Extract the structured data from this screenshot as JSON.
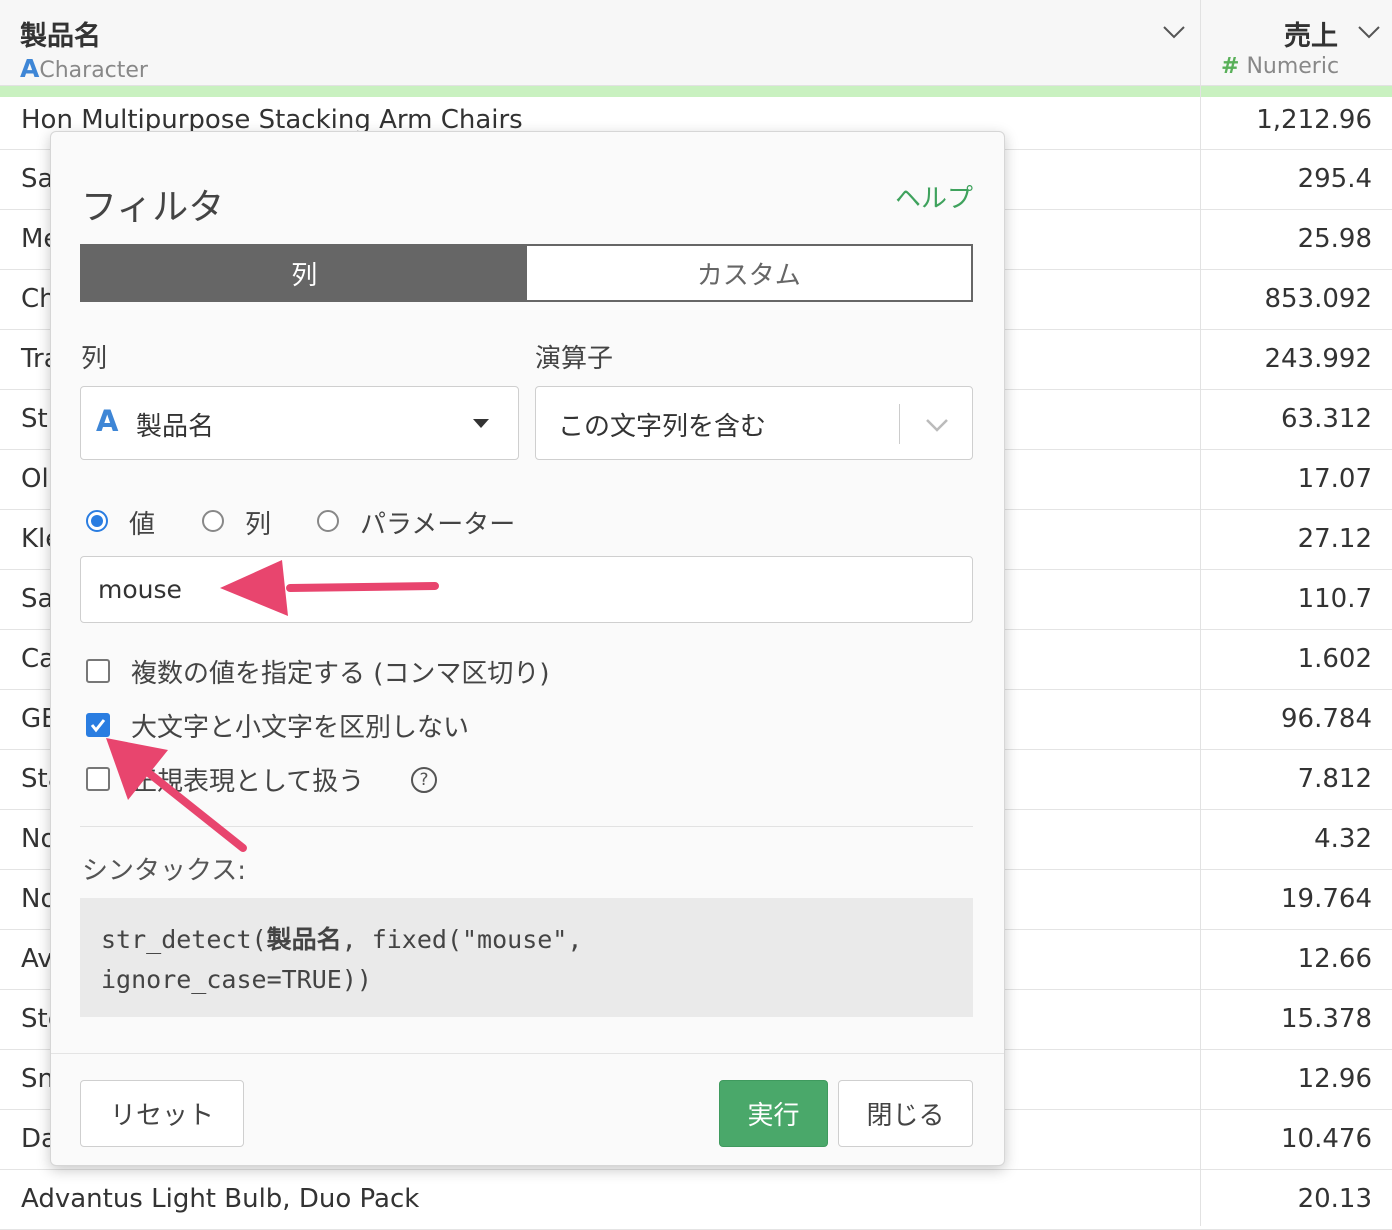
{
  "table": {
    "columns": [
      {
        "name": "製品名",
        "type_icon": "A",
        "type": "Character"
      },
      {
        "name": "売上",
        "type_icon": "#",
        "type": "Numeric"
      }
    ],
    "rows": [
      {
        "name": "Hon Multipurpose Stacking Arm Chairs",
        "value": "1,212.96"
      },
      {
        "name": "Sa",
        "value": "295.4"
      },
      {
        "name": "Me",
        "value": "25.98"
      },
      {
        "name": "Ch",
        "value": "853.092"
      },
      {
        "name": "Tra",
        "value": "243.992"
      },
      {
        "name": "St",
        "value": "63.312"
      },
      {
        "name": "Ol",
        "value": "17.07"
      },
      {
        "name": "Kle",
        "value": "27.12"
      },
      {
        "name": "Sa",
        "value": "110.7"
      },
      {
        "name": "Ca",
        "value": "1.602"
      },
      {
        "name": "GE",
        "value": "96.784"
      },
      {
        "name": "Sta",
        "value": "7.812"
      },
      {
        "name": "No",
        "value": "4.32"
      },
      {
        "name": "No",
        "value": "19.764"
      },
      {
        "name": "Av",
        "value": "12.66"
      },
      {
        "name": "Ste",
        "value": "15.378"
      },
      {
        "name": "Sn",
        "value": "12.96"
      },
      {
        "name": "Da",
        "value": "10.476"
      },
      {
        "name": "Advantus Light Bulb, Duo Pack",
        "value": "20.13"
      }
    ]
  },
  "dialog": {
    "title": "フィルタ",
    "help": "ヘルプ",
    "tabs": {
      "column": "列",
      "custom": "カスタム"
    },
    "column_label": "列",
    "operator_label": "演算子",
    "column_select": {
      "icon": "A",
      "value": "製品名"
    },
    "operator_select": {
      "value": "この文字列を含む"
    },
    "radios": {
      "value": "値",
      "column": "列",
      "parameter": "パラメーター"
    },
    "input_value": "mouse",
    "checkboxes": {
      "multiple": "複数の値を指定する (コンマ区切り)",
      "ignore_case": "大文字と小文字を区別しない",
      "regex": "正規表現として扱う"
    },
    "syntax_label": "シンタックス:",
    "syntax": {
      "line1_pre": "str_detect(",
      "line1_col": "製品名",
      "line1_post": ", fixed(\"mouse\",",
      "line2": "ignore_case=TRUE))"
    },
    "buttons": {
      "reset": "リセット",
      "run": "実行",
      "close": "閉じる"
    }
  },
  "colors": {
    "accent": "#2a7de1",
    "run_button": "#4aa86a",
    "arrow": "#e8456e",
    "header_bar": "#c9f1c0"
  }
}
